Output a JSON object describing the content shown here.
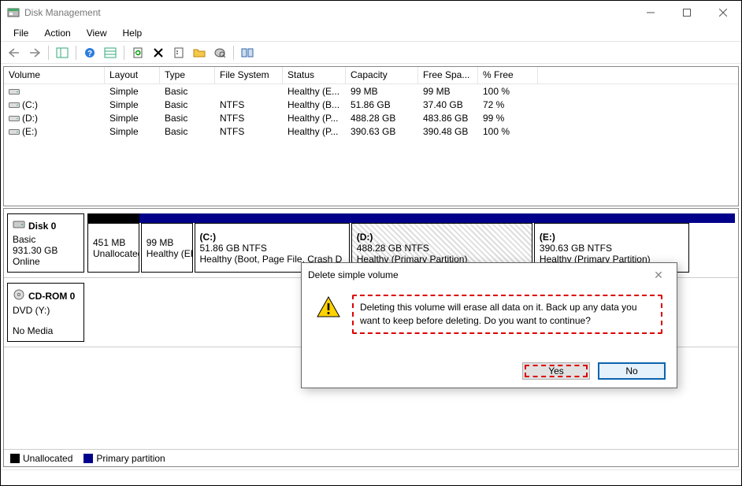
{
  "window": {
    "title": "Disk Management",
    "min": "–",
    "max": "☐",
    "close": "✕"
  },
  "menu": {
    "file": "File",
    "action": "Action",
    "view": "View",
    "help": "Help"
  },
  "columns": {
    "volume": "Volume",
    "layout": "Layout",
    "type": "Type",
    "fs": "File System",
    "status": "Status",
    "cap": "Capacity",
    "free": "Free Spa...",
    "pct": "% Free"
  },
  "volumes": [
    {
      "name": "",
      "layout": "Simple",
      "type": "Basic",
      "fs": "",
      "status": "Healthy (E...",
      "cap": "99 MB",
      "free": "99 MB",
      "pct": "100 %"
    },
    {
      "name": "(C:)",
      "layout": "Simple",
      "type": "Basic",
      "fs": "NTFS",
      "status": "Healthy (B...",
      "cap": "51.86 GB",
      "free": "37.40 GB",
      "pct": "72 %"
    },
    {
      "name": "(D:)",
      "layout": "Simple",
      "type": "Basic",
      "fs": "NTFS",
      "status": "Healthy (P...",
      "cap": "488.28 GB",
      "free": "483.86 GB",
      "pct": "99 %"
    },
    {
      "name": "(E:)",
      "layout": "Simple",
      "type": "Basic",
      "fs": "NTFS",
      "status": "Healthy (P...",
      "cap": "390.63 GB",
      "free": "390.48 GB",
      "pct": "100 %"
    }
  ],
  "disks": [
    {
      "name": "Disk 0",
      "type": "Basic",
      "size": "931.30 GB",
      "status": "Online",
      "header_segments": [
        {
          "color": "#000",
          "width": "8%"
        },
        {
          "color": "#00008b",
          "width": "92%"
        }
      ],
      "partitions": [
        {
          "label": "",
          "size": "451 MB",
          "status": "Unallocated",
          "width": "8%",
          "hatched": false
        },
        {
          "label": "",
          "size": "99 MB",
          "status": "Healthy (EFI",
          "width": "8%",
          "hatched": false
        },
        {
          "label": "(C:)",
          "size": "51.86 GB NTFS",
          "status": "Healthy (Boot, Page File, Crash D",
          "width": "24%",
          "hatched": false
        },
        {
          "label": "(D:)",
          "size": "488.28 GB NTFS",
          "status": "Healthy (Primary Partition)",
          "width": "28%",
          "hatched": true
        },
        {
          "label": "(E:)",
          "size": "390.63 GB NTFS",
          "status": "Healthy (Primary Partition)",
          "width": "24%",
          "hatched": false
        }
      ]
    },
    {
      "name": "CD-ROM 0",
      "type": "DVD (Y:)",
      "size": "",
      "status": "No Media",
      "header_segments": [],
      "partitions": []
    }
  ],
  "legend": {
    "unalloc": "Unallocated",
    "primary": "Primary partition",
    "unalloc_color": "#000",
    "primary_color": "#00008b"
  },
  "dialog": {
    "title": "Delete simple volume",
    "message": "Deleting this volume will erase all data on it. Back up any data you want to keep before deleting. Do you want to continue?",
    "yes": "Yes",
    "no": "No"
  }
}
